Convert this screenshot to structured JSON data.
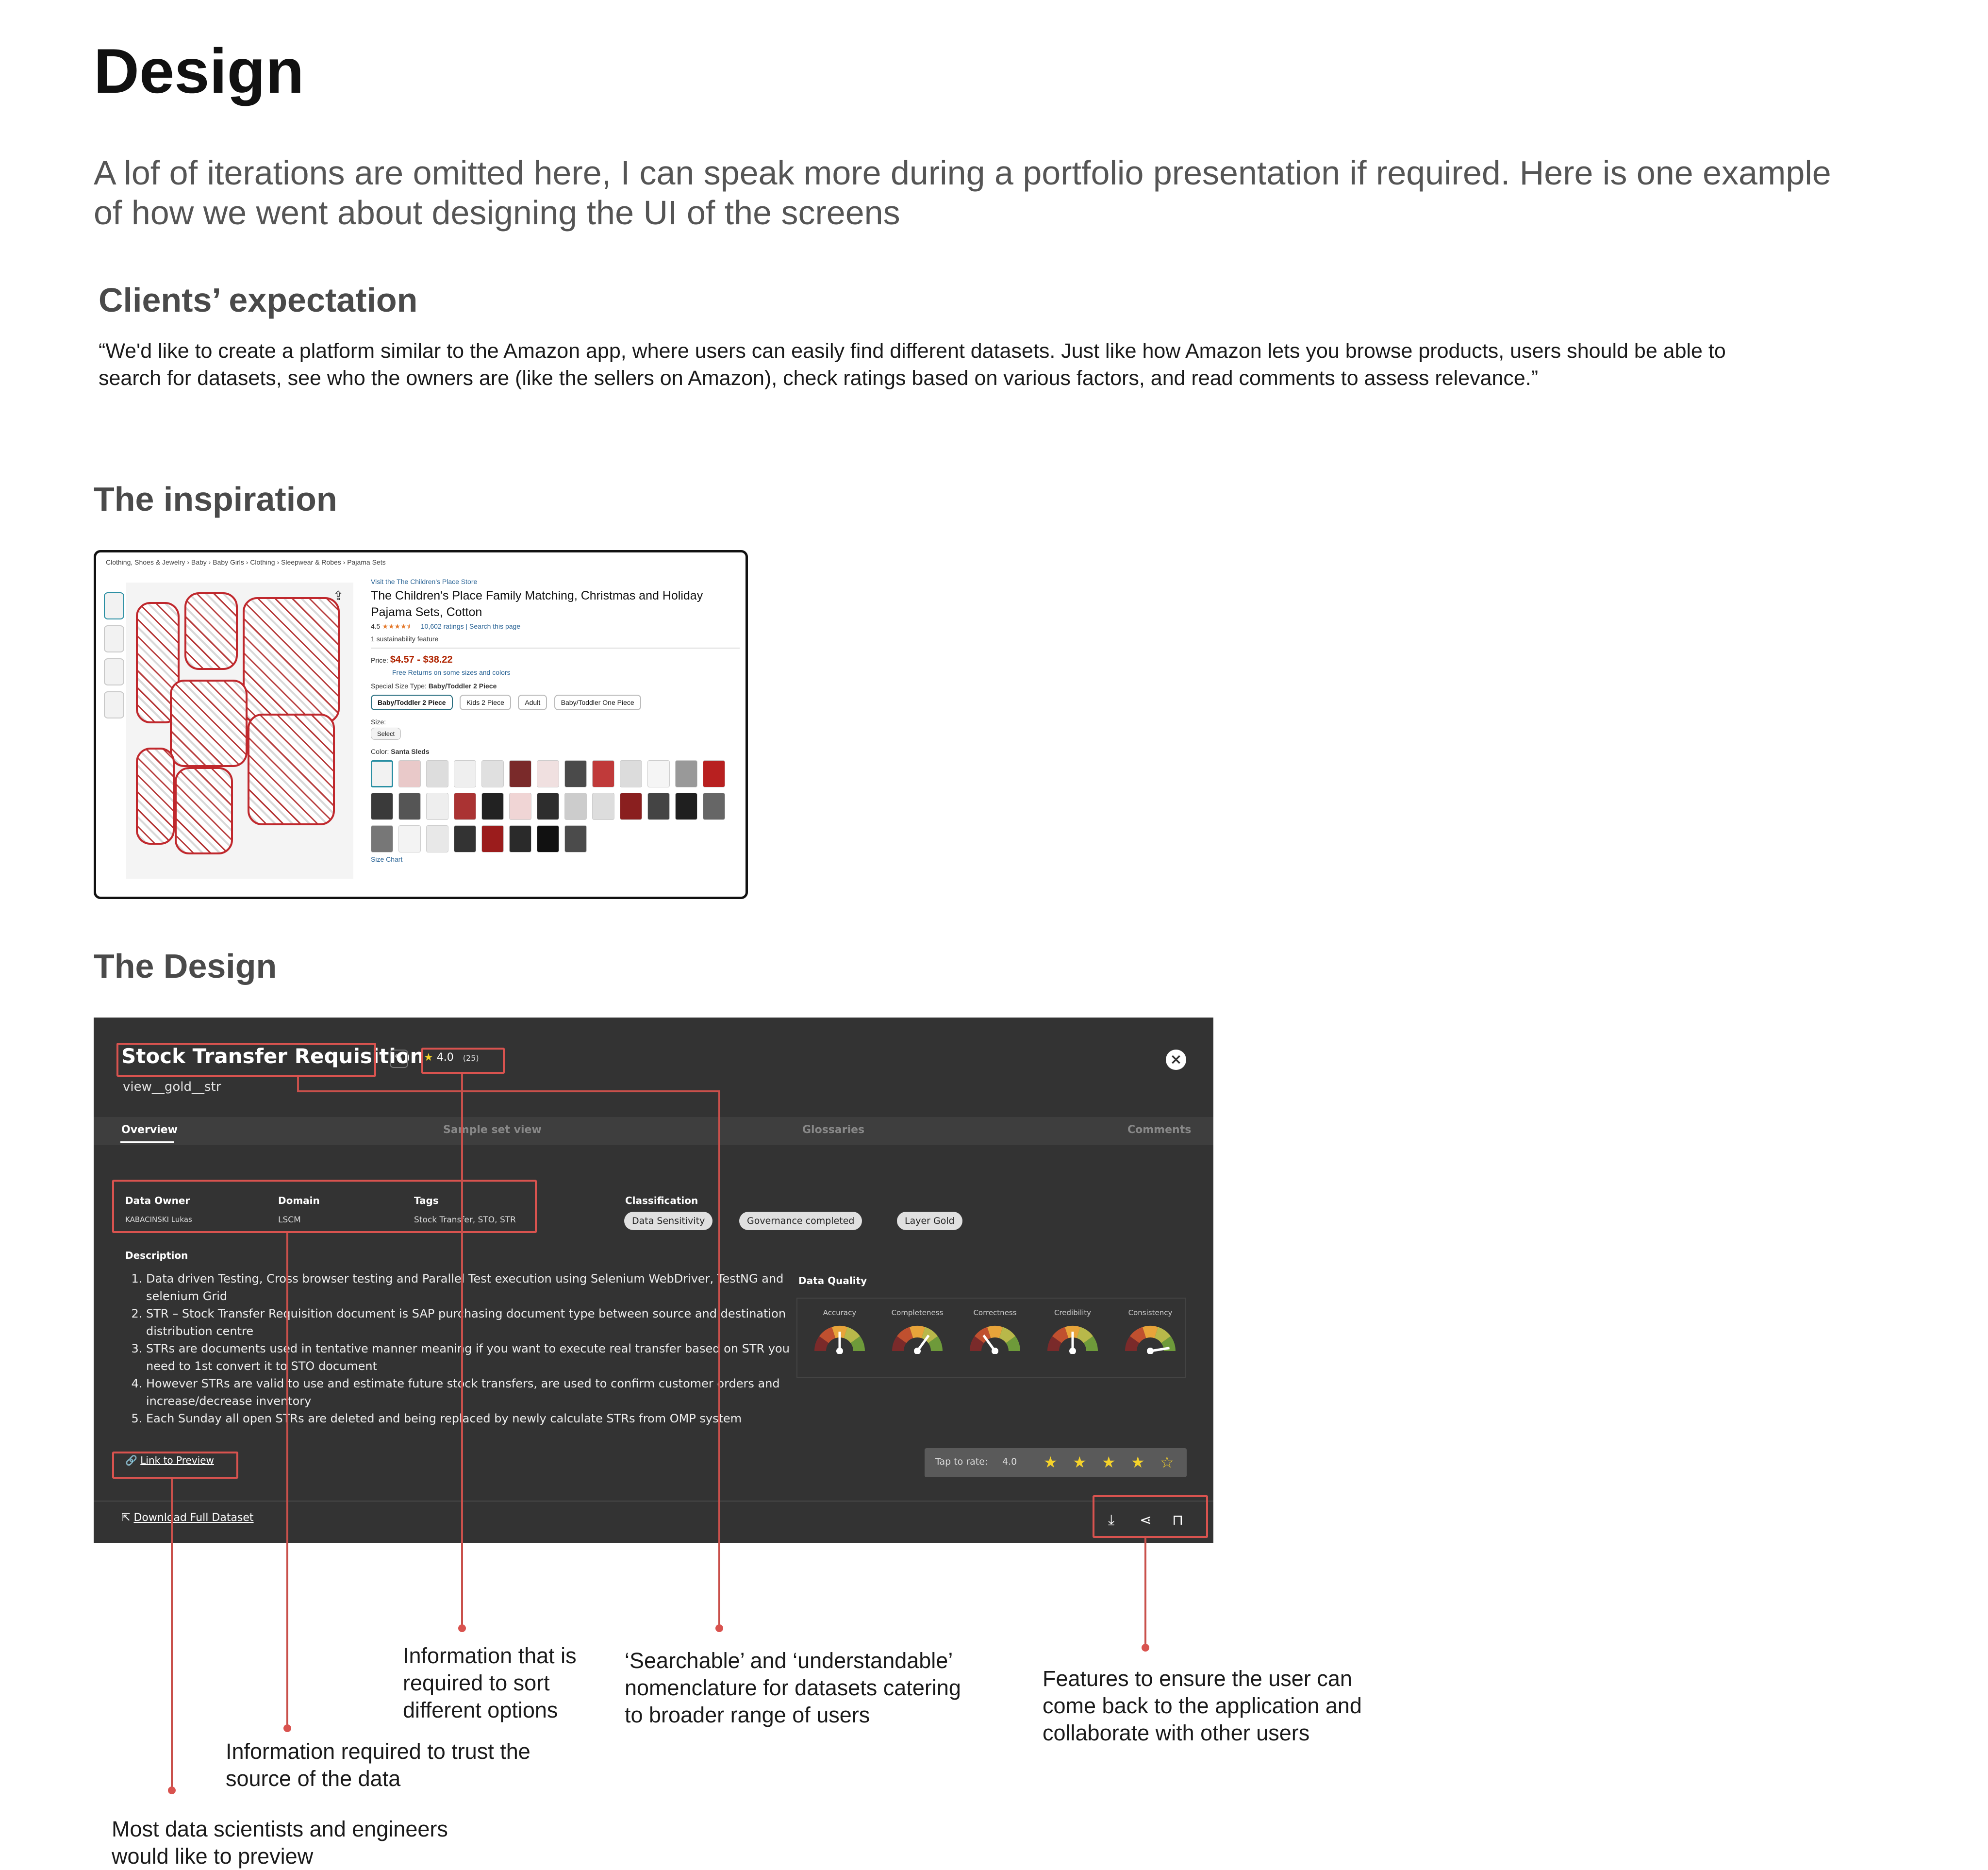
{
  "page": {
    "title": "Design",
    "intro": "A lof of iterations are omitted here, I can speak more during a portfolio presentation if required. Here is one example of how we went about designing the UI of the screens",
    "clients_heading": "Clients’ expectation",
    "clients_quote": "“We'd like to create a platform similar to the Amazon app, where users can easily find different datasets. Just like how Amazon lets you browse products, users should be able to search for datasets, see who the owners are (like the sellers on Amazon), check ratings based on various factors, and read comments to assess relevance.”",
    "inspiration_heading": "The inspiration",
    "design_heading": "The Design"
  },
  "inspiration": {
    "breadcrumb": "Clothing, Shoes & Jewelry › Baby › Baby Girls › Clothing › Sleepwear & Robes › Pajama Sets",
    "store_link": "Visit the The Children's Place Store",
    "product_title": "The Children's Place Family Matching, Christmas and Holiday Pajama Sets, Cotton",
    "rating_value": "4.5",
    "rating_stars": "★★★★⯨",
    "ratings_count": "10,602 ratings",
    "search_link": "Search this page",
    "sustainability": "1 sustainability feature",
    "price_label": "Price:",
    "price": "$4.57 - $38.22",
    "free_returns": "Free Returns on some sizes and colors",
    "size_type_label": "Special Size Type:",
    "size_type_value": "Baby/Toddler 2 Piece",
    "size_options": [
      "Baby/Toddler 2 Piece",
      "Kids 2 Piece",
      "Adult",
      "Baby/Toddler One Piece"
    ],
    "size_label": "Size:",
    "size_select": "Select",
    "color_label": "Color:",
    "color_value": "Santa Sleds",
    "size_chart": "Size Chart",
    "share_icon": "share-icon"
  },
  "design": {
    "title": "Stock Transfer Requisition",
    "subtitle": "view__gold__str",
    "rating": "4.0",
    "rating_count": "(25)",
    "tabs": [
      "Overview",
      "Sample set view",
      "Glossaries",
      "Comments"
    ],
    "data_owner_label": "Data Owner",
    "data_owner": "KABACINSKI Lukas",
    "domain_label": "Domain",
    "domain": "LSCM",
    "tags_label": "Tags",
    "tags": "Stock Transfer,   STO,   STR",
    "classification_label": "Classification",
    "chips": [
      "Data Sensitivity",
      "Governance completed",
      "Layer Gold"
    ],
    "description_label": "Description",
    "description": [
      "Data driven Testing, Cross browser testing and Parallel Test execution using Selenium WebDriver, TestNG and selenium Grid",
      "STR – Stock Transfer Requisition document is SAP purchasing document type between source and destination distribution centre",
      "STRs are documents used in tentative manner meaning if you want to execute real transfer based on STR you need to 1st convert it to STO document",
      "However STRs are valid to use and estimate future stock transfers, are used to confirm customer orders and increase/decrease inventory",
      "Each Sunday all open STRs are deleted and being replaced by newly calculate STRs from OMP system"
    ],
    "data_quality_label": "Data Quality",
    "gauges": [
      {
        "label": "Accuracy",
        "level": 0.5
      },
      {
        "label": "Completeness",
        "level": 0.7
      },
      {
        "label": "Correctness",
        "level": 0.3
      },
      {
        "label": "Credibility",
        "level": 0.5
      },
      {
        "label": "Consistency",
        "level": 0.95
      }
    ],
    "tap_to_rate": "Tap to rate:",
    "tap_rating": "4.0",
    "stars_filled": 4,
    "stars_total": 5,
    "link_preview": "Link to Preview",
    "download": "Download Full Dataset",
    "icons": [
      "download-icon",
      "share-icon",
      "bookmark-icon"
    ]
  },
  "annotations": {
    "preview": "Most data scientists and engineers would like to preview",
    "trust": "Information required to trust the source of the data",
    "sort": "Information that is required to sort different options",
    "nomenclature": "‘Searchable’ and ‘understandable’ nomenclature for datasets catering to broader range of users",
    "collaborate": "Features to ensure the user can come back to the application and collaborate with other users"
  },
  "colors": {
    "annotation_red": "#d9534f",
    "panel_bg": "#333333",
    "star_yellow": "#f5d22a",
    "amazon_price": "#b12704"
  }
}
